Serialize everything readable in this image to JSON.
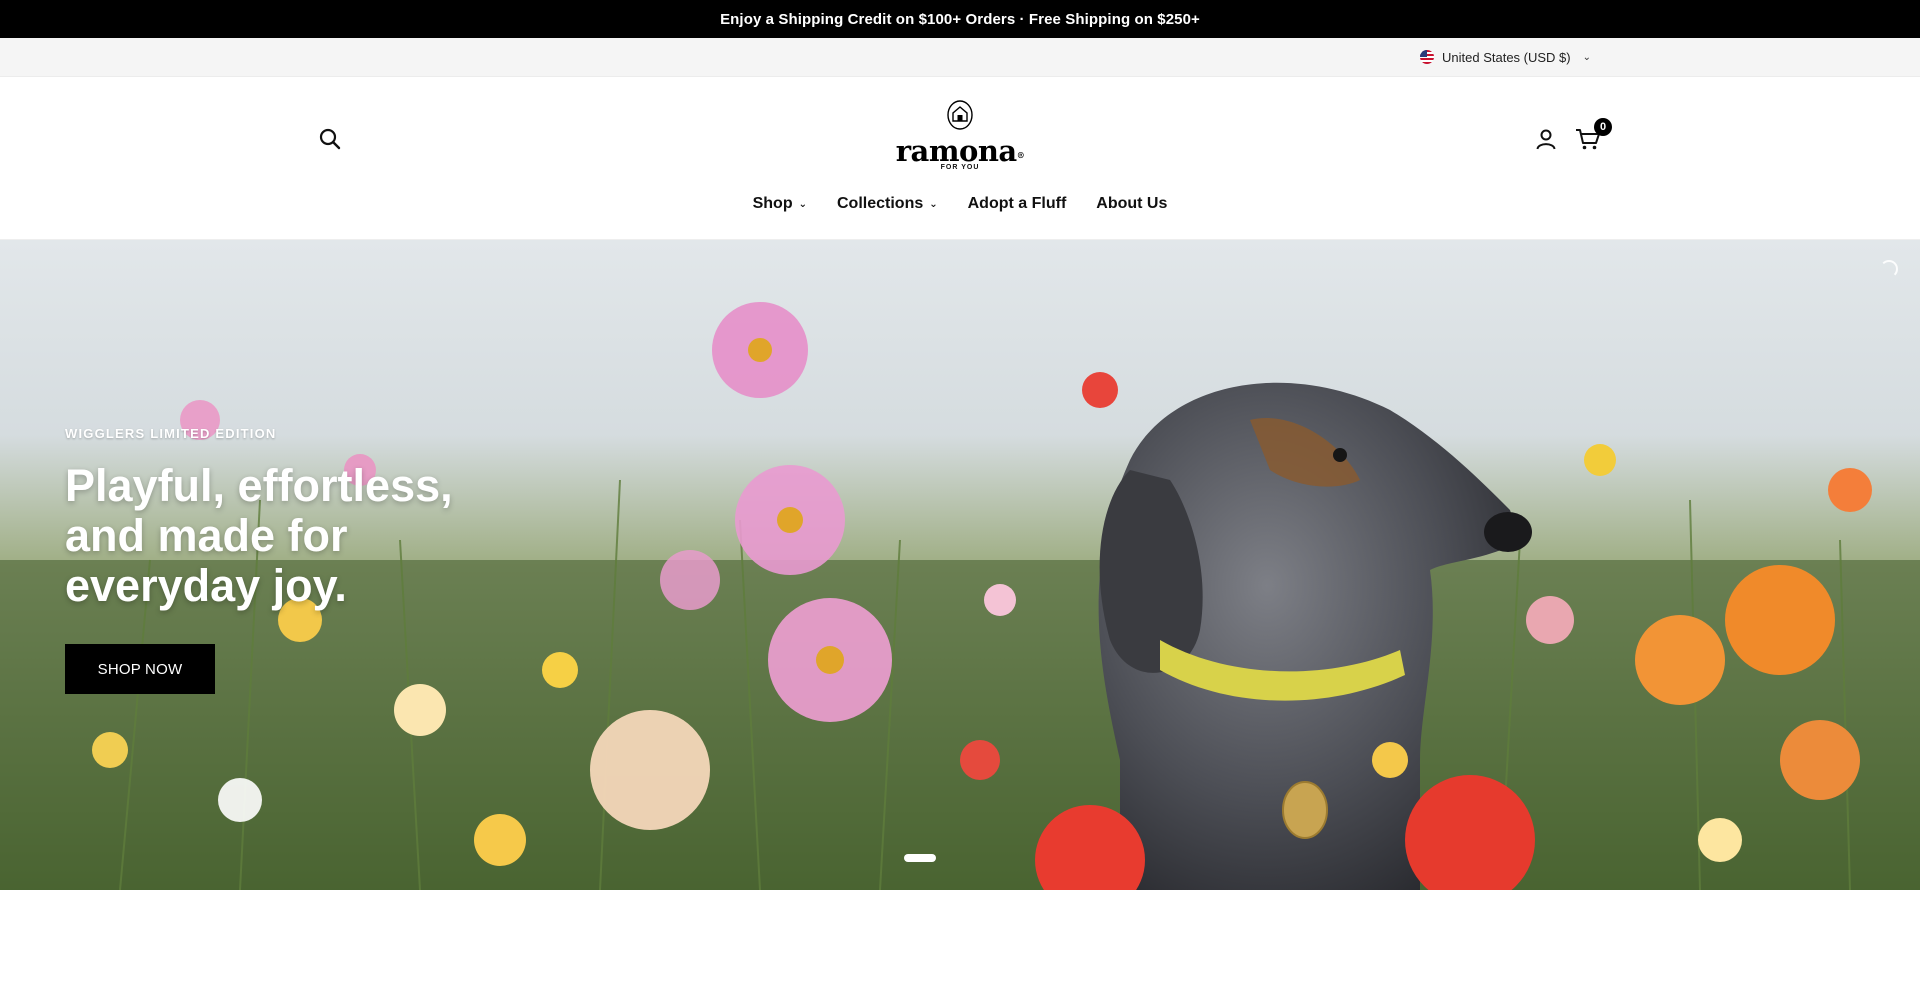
{
  "announcement": {
    "text": "Enjoy a Shipping Credit on $100+ Orders · Free Shipping on $250+"
  },
  "locale": {
    "label": "United States (USD $)",
    "flag_icon": "us-flag-icon"
  },
  "header": {
    "logo_word": "ramona",
    "logo_mark": "®",
    "logo_sub": "FOR YOU",
    "cart_count": "0",
    "icons": [
      "search-icon",
      "account-icon",
      "cart-icon"
    ]
  },
  "nav": {
    "items": [
      {
        "label": "Shop",
        "has_dropdown": true
      },
      {
        "label": "Collections",
        "has_dropdown": true
      },
      {
        "label": "Adopt a Fluff",
        "has_dropdown": false
      },
      {
        "label": "About Us",
        "has_dropdown": false
      }
    ]
  },
  "hero": {
    "eyebrow": "WIGGLERS LIMITED EDITION",
    "headline": "Playful, effortless, and made for everyday joy.",
    "cta_label": "SHOP NOW",
    "slide_index": 1
  },
  "colors": {
    "announcement_bg": "#000000",
    "cta_bg": "#000000",
    "locale_bg": "#f5f5f5"
  }
}
